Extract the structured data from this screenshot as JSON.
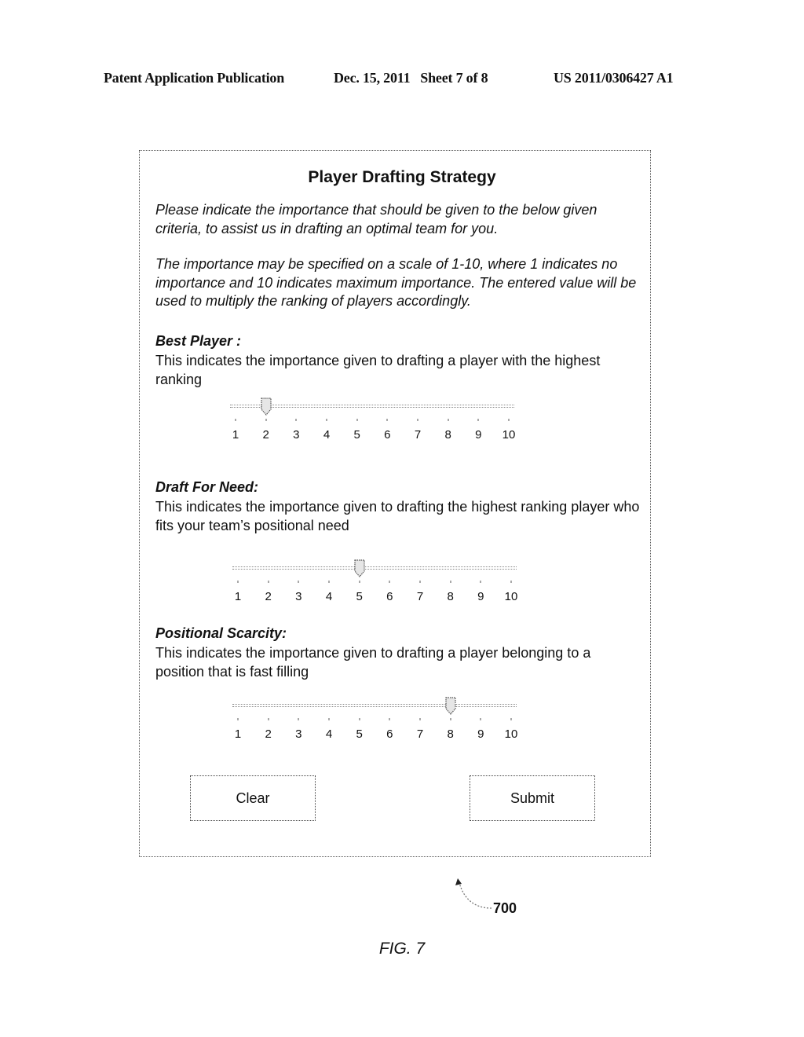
{
  "header": {
    "publication": "Patent Application Publication",
    "date_sheet": "Dec. 15, 2011   Sheet 7 of 8",
    "patent_number": "US 2011/0306427 A1"
  },
  "form": {
    "title": "Player Drafting Strategy",
    "intro": [
      "Please indicate the importance that should be given to the below given criteria, to assist us in drafting an optimal team for you.",
      "The importance may be specified on a scale of 1-10, where 1 indicates no importance and 10 indicates maximum importance. The entered value will be used to multiply the ranking of players accordingly."
    ],
    "scale": {
      "min": 1,
      "max": 10,
      "labels": [
        "1",
        "2",
        "3",
        "4",
        "5",
        "6",
        "7",
        "8",
        "9",
        "10"
      ]
    },
    "criteria": [
      {
        "title": "Best Player :",
        "description": "This indicates the importance given to drafting a player with the highest ranking",
        "value": 2
      },
      {
        "title": "Draft For Need:",
        "description": "This indicates the importance given to drafting the highest ranking player who fits your team’s positional need",
        "value": 5
      },
      {
        "title": "Positional Scarcity:",
        "description": "This indicates the importance given to drafting a player belonging to a position that is fast filling",
        "value": 8
      }
    ],
    "buttons": {
      "clear": "Clear",
      "submit": "Submit"
    }
  },
  "annotations": {
    "reference_numeral": "700",
    "figure_label": "FIG. 7"
  }
}
